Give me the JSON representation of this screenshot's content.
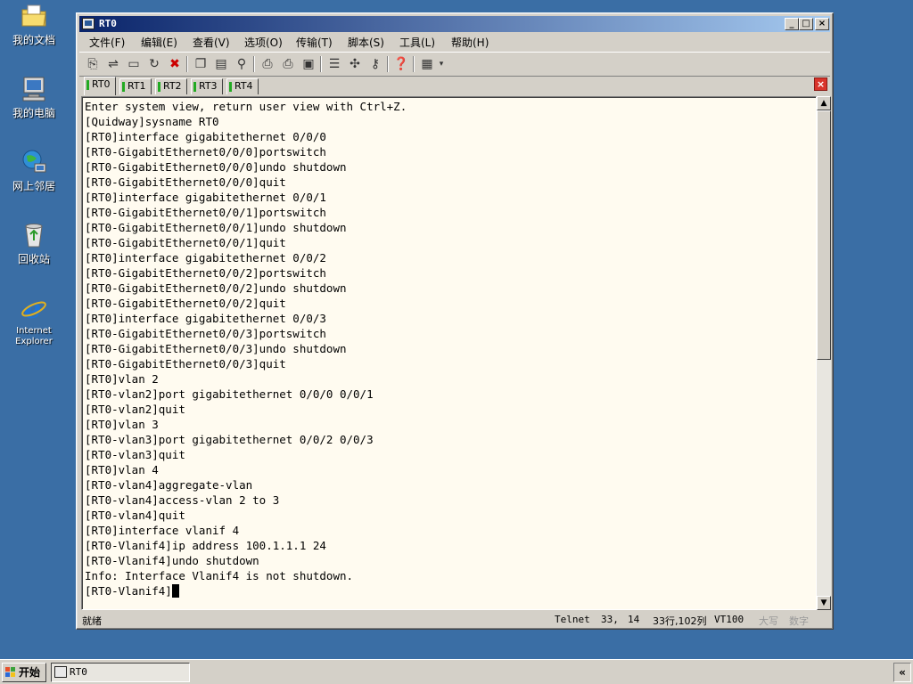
{
  "desktop": {
    "icons": [
      {
        "label": "我的文档",
        "icon": "folder-documents-icon"
      },
      {
        "label": "我的电脑",
        "icon": "computer-icon"
      },
      {
        "label": "网上邻居",
        "icon": "network-icon"
      },
      {
        "label": "回收站",
        "icon": "recycle-bin-icon"
      },
      {
        "label": "Internet Explorer",
        "icon": "internet-explorer-icon"
      }
    ]
  },
  "window": {
    "title": "RT0",
    "menu": [
      "文件(F)",
      "编辑(E)",
      "查看(V)",
      "选项(O)",
      "传输(T)",
      "脚本(S)",
      "工具(L)",
      "帮助(H)"
    ],
    "tabs": [
      "RT0",
      "RT1",
      "RT2",
      "RT3",
      "RT4"
    ],
    "active_tab": "RT0",
    "terminal_lines": [
      "Enter system view, return user view with Ctrl+Z.",
      "[Quidway]sysname RT0",
      "[RT0]interface gigabitethernet 0/0/0",
      "[RT0-GigabitEthernet0/0/0]portswitch",
      "[RT0-GigabitEthernet0/0/0]undo shutdown",
      "[RT0-GigabitEthernet0/0/0]quit",
      "[RT0]interface gigabitethernet 0/0/1",
      "[RT0-GigabitEthernet0/0/1]portswitch",
      "[RT0-GigabitEthernet0/0/1]undo shutdown",
      "[RT0-GigabitEthernet0/0/1]quit",
      "[RT0]interface gigabitethernet 0/0/2",
      "[RT0-GigabitEthernet0/0/2]portswitch",
      "[RT0-GigabitEthernet0/0/2]undo shutdown",
      "[RT0-GigabitEthernet0/0/2]quit",
      "[RT0]interface gigabitethernet 0/0/3",
      "[RT0-GigabitEthernet0/0/3]portswitch",
      "[RT0-GigabitEthernet0/0/3]undo shutdown",
      "[RT0-GigabitEthernet0/0/3]quit",
      "[RT0]vlan 2",
      "[RT0-vlan2]port gigabitethernet 0/0/0 0/0/1",
      "[RT0-vlan2]quit",
      "[RT0]vlan 3",
      "[RT0-vlan3]port gigabitethernet 0/0/2 0/0/3",
      "[RT0-vlan3]quit",
      "[RT0]vlan 4",
      "[RT0-vlan4]aggregate-vlan",
      "[RT0-vlan4]access-vlan 2 to 3",
      "[RT0-vlan4]quit",
      "[RT0]interface vlanif 4",
      "[RT0-Vlanif4]ip address 100.1.1.1 24",
      "[RT0-Vlanif4]undo shutdown",
      "Info: Interface Vlanif4 is not shutdown.",
      "[RT0-Vlanif4]"
    ],
    "status": {
      "ready": "就绪",
      "protocol": "Telnet",
      "row": "33,",
      "col": "14",
      "size": "33行,102列",
      "term_type": "VT100",
      "caps": "大写",
      "num": "数字"
    }
  },
  "taskbar": {
    "start_label": "开始",
    "task_label": "RT0",
    "tray_label": "«"
  },
  "colors": {
    "desktop": "#3a6ea5",
    "title_start": "#0a246a",
    "title_end": "#a6caf0",
    "terminal_bg": "#fffbf0"
  }
}
